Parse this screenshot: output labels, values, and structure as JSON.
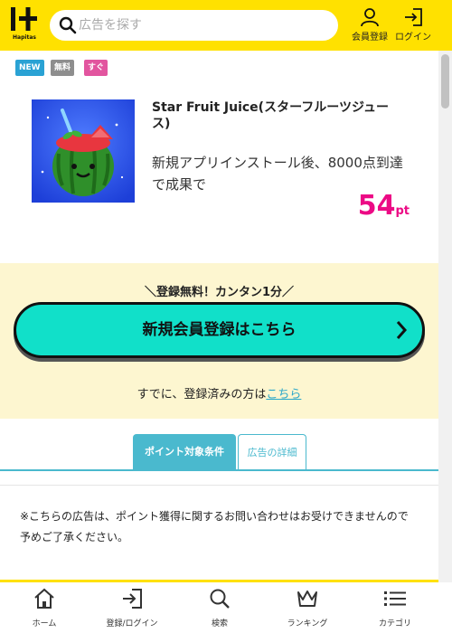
{
  "header": {
    "logo_sub": "Hapitas",
    "search_placeholder": "広告を探す",
    "signup_label": "会員登録",
    "login_label": "ログイン"
  },
  "badges": [
    "NEW",
    "無料",
    "すぐ"
  ],
  "badge_colors": [
    "#2aa2d4",
    "#8e8e8e",
    "#e2559f"
  ],
  "offer": {
    "title": "Star Fruit Juice(スターフルーツジュース)",
    "description": "新規アプリインストール後、8000点到達で成果で",
    "points": "54",
    "points_unit": "pt"
  },
  "registration": {
    "tagline": "＼登録無料！カンタン1分／",
    "button_label": "新規会員登録はこちら",
    "login_prompt": "すでに、登録済みの方は",
    "login_link": "こちら"
  },
  "tabs": [
    {
      "label": "ポイント対象条件",
      "active": true
    },
    {
      "label": "広告の詳細",
      "active": false
    }
  ],
  "notice": "※こちらの広告は、ポイント獲得に関するお問い合わせはお受けできませんので予めご了承ください。",
  "bottom_nav": [
    {
      "label": "ホーム",
      "icon": "home-icon"
    },
    {
      "label": "登録/ログイン",
      "icon": "login-icon"
    },
    {
      "label": "検索",
      "icon": "search-icon"
    },
    {
      "label": "ランキング",
      "icon": "crown-icon"
    },
    {
      "label": "カテゴリ",
      "icon": "list-icon"
    }
  ],
  "colors": {
    "brand_yellow": "#ffe100",
    "accent_teal": "#11e0c9",
    "tab_blue": "#4ab9ce",
    "points_pink": "#ec0a85",
    "reg_bg": "#fdf6d0"
  }
}
